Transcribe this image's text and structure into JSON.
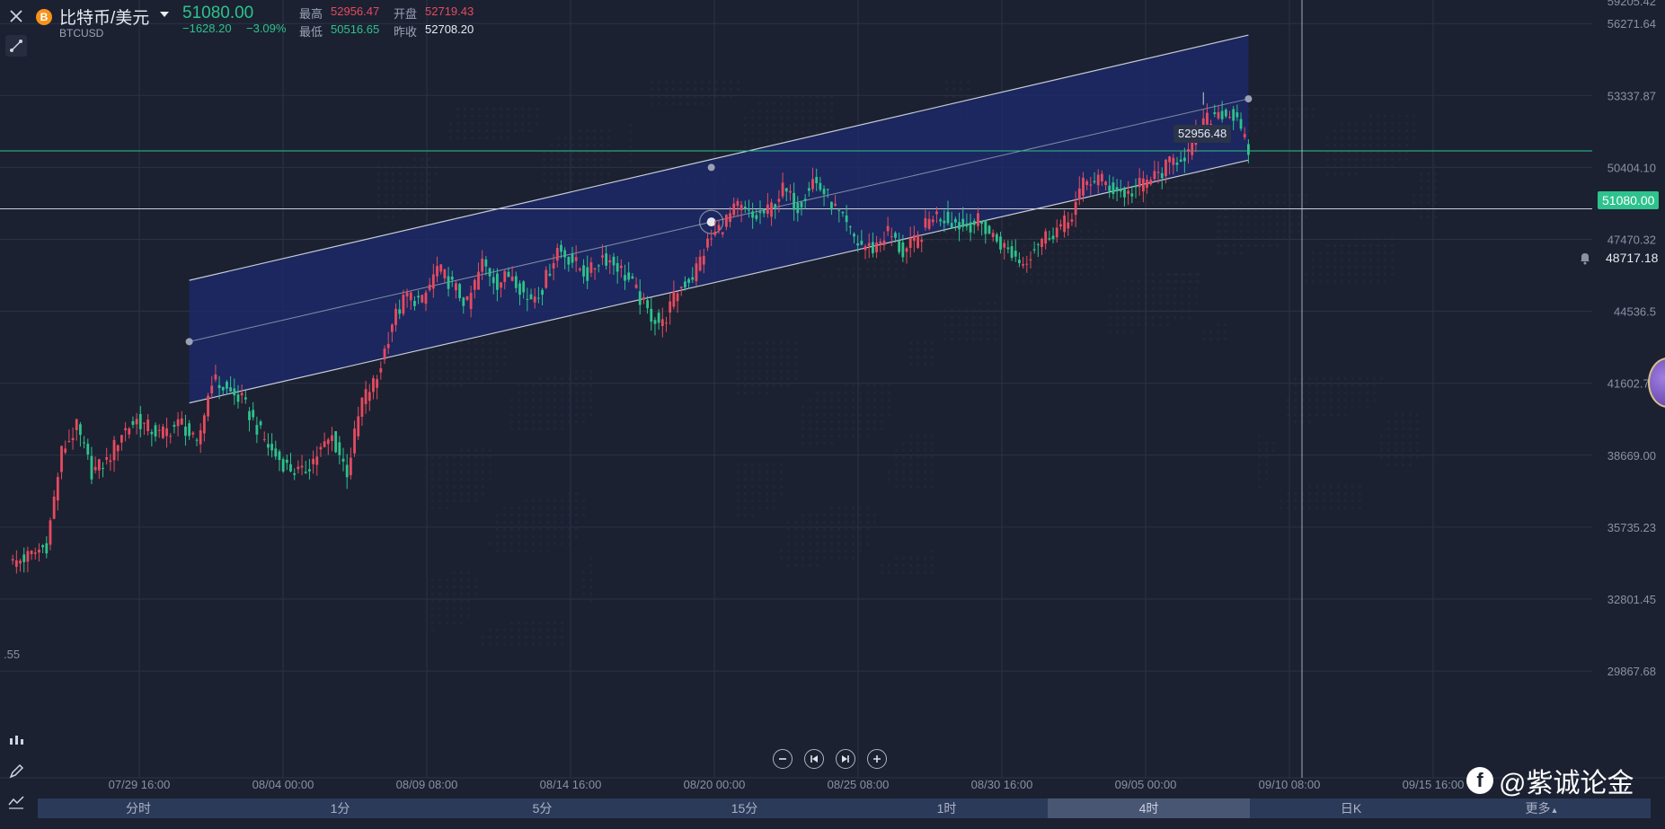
{
  "header": {
    "symbol_name": "比特币/美元",
    "symbol_code": "BTCUSD",
    "coin_glyph": "B",
    "last_price": "51080.00",
    "change": "−1628.20",
    "change_pct": "−3.09%",
    "high_label": "最高",
    "high_value": "52956.47",
    "open_label": "开盘",
    "open_value": "52719.43",
    "low_label": "最低",
    "low_value": "50516.65",
    "prev_close_label": "昨收",
    "prev_close_value": "52708.20"
  },
  "price_axis": {
    "ticks": [
      "56271.64",
      "53337.87",
      "50404.10",
      "47470.32",
      "44536.5",
      "41602.78",
      "38669.00",
      "35735.23",
      "32801.45",
      "29867.68"
    ],
    "top_partial": "59205.42",
    "left_partial": ".55"
  },
  "time_axis": {
    "ticks": [
      "07/29 16:00",
      "08/04 00:00",
      "08/09 08:00",
      "08/14 16:00",
      "08/20 00:00",
      "08/25 08:00",
      "08/30 16:00",
      "09/05 00:00",
      "09/10 08:00",
      "09/15 16:00"
    ]
  },
  "price_tags": {
    "current": "51080.00",
    "alert": "48717.18",
    "high_marker": "52956.48"
  },
  "timeframes": {
    "items": [
      "分时",
      "1分",
      "5分",
      "15分",
      "1时",
      "4时",
      "日K",
      "更多"
    ],
    "active": "4时"
  },
  "watermark": "@紫诚论金",
  "colors": {
    "background": "#1b2131",
    "up": "#e64a5f",
    "down": "#2ec28c",
    "channel_fill": "#1c2a6e",
    "current_line": "#2ec28c"
  },
  "chart_data": {
    "type": "candlestick",
    "symbol": "BTCUSD",
    "interval": "4时",
    "ylim": [
      28000,
      60000
    ],
    "x_ticks": [
      "07/29 16:00",
      "08/04 00:00",
      "08/09 08:00",
      "08/14 16:00",
      "08/20 00:00",
      "08/25 08:00",
      "08/30 16:00",
      "09/05 00:00",
      "09/10 08:00",
      "09/15 16:00"
    ],
    "y_ticks": [
      56271.64,
      53337.87,
      50404.1,
      47470.32,
      44536.5,
      41602.78,
      38669.0,
      35735.23,
      32801.45,
      29867.68
    ],
    "current_price": 51080.0,
    "alert_price": 48717.18,
    "session_high": 52956.48,
    "close_path": [
      [
        0,
        34200
      ],
      [
        6,
        34600
      ],
      [
        10,
        35000
      ],
      [
        14,
        38800
      ],
      [
        18,
        39800
      ],
      [
        22,
        38000
      ],
      [
        26,
        38400
      ],
      [
        30,
        39600
      ],
      [
        34,
        40100
      ],
      [
        40,
        39500
      ],
      [
        46,
        40000
      ],
      [
        50,
        39000
      ],
      [
        54,
        41800
      ],
      [
        58,
        41300
      ],
      [
        62,
        40900
      ],
      [
        66,
        39800
      ],
      [
        70,
        38800
      ],
      [
        74,
        38200
      ],
      [
        78,
        37900
      ],
      [
        82,
        38700
      ],
      [
        86,
        39400
      ],
      [
        90,
        38000
      ],
      [
        94,
        40900
      ],
      [
        98,
        41800
      ],
      [
        102,
        44100
      ],
      [
        106,
        45200
      ],
      [
        110,
        44900
      ],
      [
        114,
        46300
      ],
      [
        118,
        45600
      ],
      [
        122,
        44800
      ],
      [
        126,
        46500
      ],
      [
        130,
        45700
      ],
      [
        134,
        46100
      ],
      [
        138,
        45000
      ],
      [
        142,
        45500
      ],
      [
        146,
        47100
      ],
      [
        150,
        46600
      ],
      [
        154,
        46000
      ],
      [
        158,
        46800
      ],
      [
        162,
        46400
      ],
      [
        166,
        45600
      ],
      [
        170,
        44500
      ],
      [
        174,
        44000
      ],
      [
        178,
        45400
      ],
      [
        182,
        46000
      ],
      [
        186,
        47300
      ],
      [
        190,
        48100
      ],
      [
        194,
        48800
      ],
      [
        198,
        48300
      ],
      [
        202,
        48600
      ],
      [
        206,
        49500
      ],
      [
        210,
        48800
      ],
      [
        214,
        49900
      ],
      [
        218,
        49200
      ],
      [
        222,
        48200
      ],
      [
        226,
        47300
      ],
      [
        230,
        47100
      ],
      [
        234,
        47800
      ],
      [
        238,
        46900
      ],
      [
        242,
        47500
      ],
      [
        246,
        48500
      ],
      [
        250,
        48300
      ],
      [
        254,
        48000
      ],
      [
        258,
        48200
      ],
      [
        262,
        47600
      ],
      [
        266,
        47000
      ],
      [
        270,
        46500
      ],
      [
        274,
        47400
      ],
      [
        278,
        47800
      ],
      [
        282,
        48200
      ],
      [
        286,
        49700
      ],
      [
        290,
        50000
      ],
      [
        294,
        49500
      ],
      [
        298,
        49300
      ],
      [
        302,
        49800
      ],
      [
        306,
        50100
      ],
      [
        310,
        50700
      ],
      [
        314,
        51000
      ],
      [
        318,
        52200
      ],
      [
        322,
        52700
      ],
      [
        326,
        52500
      ],
      [
        330,
        51080
      ]
    ],
    "channel": {
      "upper": [
        [
          48,
          45800
        ],
        [
          330,
          55800
        ]
      ],
      "middle": [
        [
          48,
          43300
        ],
        [
          330,
          53200
        ]
      ],
      "lower": [
        [
          48,
          40800
        ],
        [
          330,
          50700
        ]
      ]
    }
  }
}
